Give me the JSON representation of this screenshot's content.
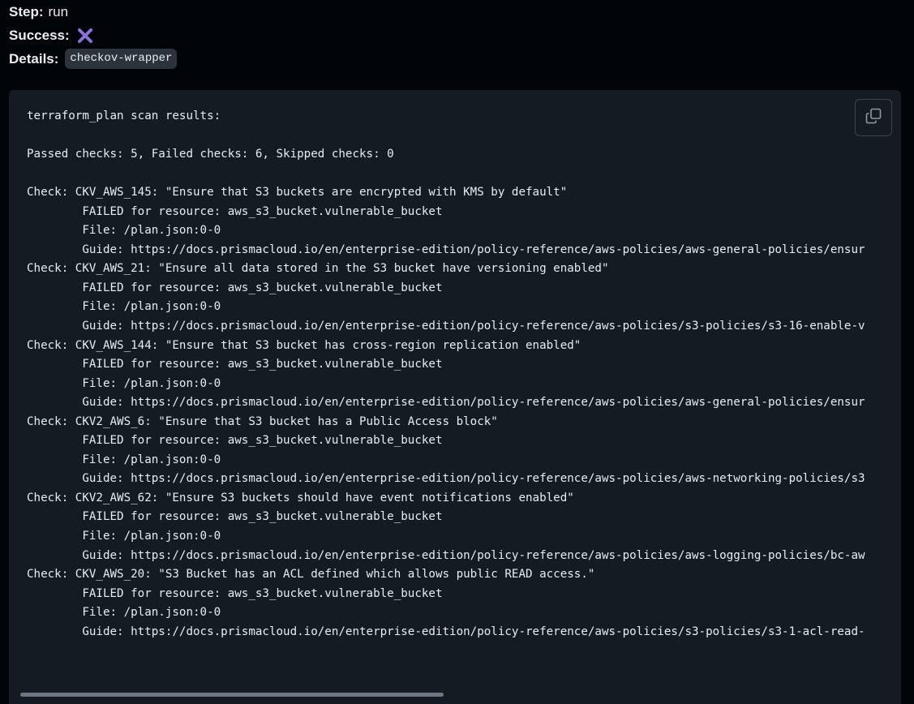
{
  "meta": {
    "step_label": "Step",
    "step_value": "run",
    "success_label": "Success",
    "details_label": "Details",
    "details_value": "checkov-wrapper",
    "x_icon_color": "#8b72d6"
  },
  "output": {
    "lines": [
      "terraform_plan scan results:",
      "",
      "Passed checks: 5, Failed checks: 6, Skipped checks: 0",
      "",
      "Check: CKV_AWS_145: \"Ensure that S3 buckets are encrypted with KMS by default\"",
      "        FAILED for resource: aws_s3_bucket.vulnerable_bucket",
      "        File: /plan.json:0-0",
      "        Guide: https://docs.prismacloud.io/en/enterprise-edition/policy-reference/aws-policies/aws-general-policies/ensur",
      "Check: CKV_AWS_21: \"Ensure all data stored in the S3 bucket have versioning enabled\"",
      "        FAILED for resource: aws_s3_bucket.vulnerable_bucket",
      "        File: /plan.json:0-0",
      "        Guide: https://docs.prismacloud.io/en/enterprise-edition/policy-reference/aws-policies/s3-policies/s3-16-enable-v",
      "Check: CKV_AWS_144: \"Ensure that S3 bucket has cross-region replication enabled\"",
      "        FAILED for resource: aws_s3_bucket.vulnerable_bucket",
      "        File: /plan.json:0-0",
      "        Guide: https://docs.prismacloud.io/en/enterprise-edition/policy-reference/aws-policies/aws-general-policies/ensur",
      "Check: CKV2_AWS_6: \"Ensure that S3 bucket has a Public Access block\"",
      "        FAILED for resource: aws_s3_bucket.vulnerable_bucket",
      "        File: /plan.json:0-0",
      "        Guide: https://docs.prismacloud.io/en/enterprise-edition/policy-reference/aws-policies/aws-networking-policies/s3",
      "Check: CKV2_AWS_62: \"Ensure S3 buckets should have event notifications enabled\"",
      "        FAILED for resource: aws_s3_bucket.vulnerable_bucket",
      "        File: /plan.json:0-0",
      "        Guide: https://docs.prismacloud.io/en/enterprise-edition/policy-reference/aws-policies/aws-logging-policies/bc-aw",
      "Check: CKV_AWS_20: \"S3 Bucket has an ACL defined which allows public READ access.\"",
      "        FAILED for resource: aws_s3_bucket.vulnerable_bucket",
      "        File: /plan.json:0-0",
      "        Guide: https://docs.prismacloud.io/en/enterprise-edition/policy-reference/aws-policies/s3-policies/s3-1-acl-read-"
    ]
  },
  "icons": {
    "status": "x-mark-icon",
    "copy": "copy-icon"
  }
}
